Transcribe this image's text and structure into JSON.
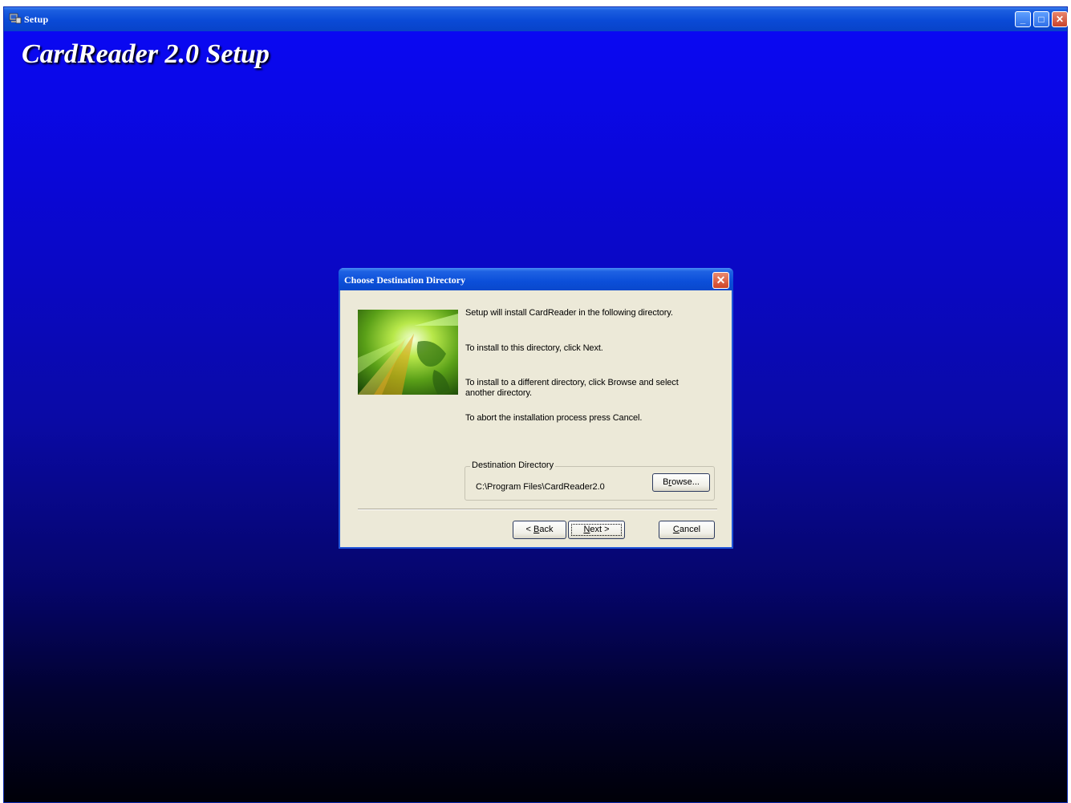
{
  "window": {
    "title": "Setup",
    "heading": "CardReader 2.0 Setup",
    "minimize_glyph": "_",
    "maximize_glyph": "□",
    "close_glyph": "✕"
  },
  "dialog": {
    "title": "Choose Destination Directory",
    "close_glyph": "✕",
    "line1": "Setup will install CardReader in the following directory.",
    "line2": "To install to this directory, click Next.",
    "line3a": "To install to a different directory, click Browse and select",
    "line3b": "another directory.",
    "line4": "To abort the installation process press Cancel.",
    "group_label": "Destination Directory",
    "destination_path": "C:\\Program Files\\CardReader2.0",
    "browse_pre": "B",
    "browse_accel": "r",
    "browse_post": "owse...",
    "back_pre": "< ",
    "back_accel": "B",
    "back_post": "ack",
    "next_accel": "N",
    "next_post": "ext >",
    "cancel_accel": "C",
    "cancel_post": "ancel"
  },
  "icons": {
    "window_icon": "setup-computer-icon",
    "dialog_image": "globe-light-graphic"
  }
}
